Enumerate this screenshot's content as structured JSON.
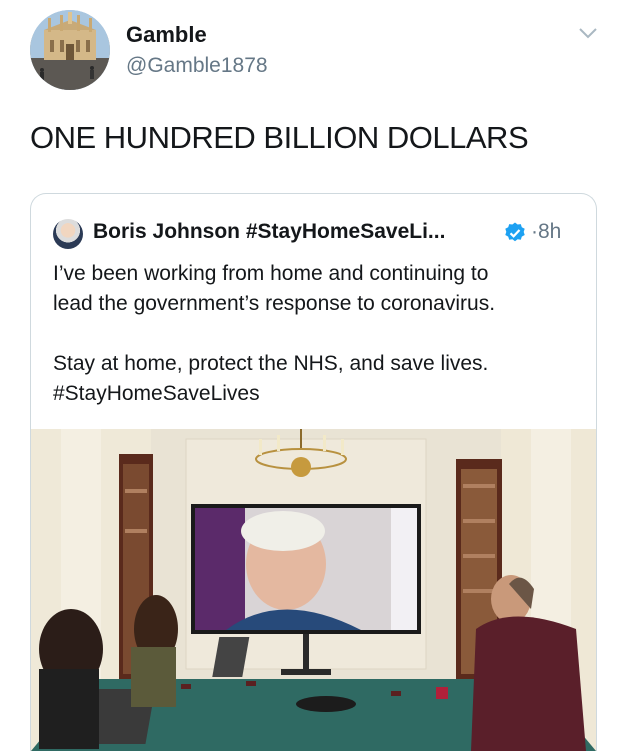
{
  "tweet": {
    "display_name": "Gamble",
    "handle": "@Gamble1878",
    "text": "ONE HUNDRED BILLION DOLLARS"
  },
  "quoted": {
    "display_name": "Boris Johnson #StayHomeSaveLi...",
    "time": "8h",
    "separator": "·",
    "line1": "I’ve been working from home and continuing to",
    "line2": "lead the government’s response to coronavirus.",
    "line3": "Stay at home, protect the NHS, and save lives.",
    "line4": "#StayHomeSaveLives"
  },
  "colors": {
    "primary_text": "#14171a",
    "secondary_text": "#657786",
    "verified_blue": "#1da1f2",
    "border": "#cfd9de",
    "table_green": "#2f6a63"
  },
  "icons": {
    "chevron": "chevron-down-icon",
    "verified": "verified-badge-icon"
  }
}
